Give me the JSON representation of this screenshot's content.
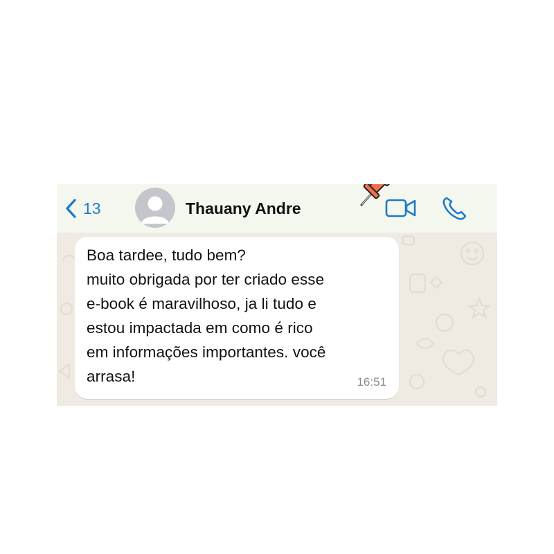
{
  "header": {
    "back_count": "13",
    "contact_name": "Thauany Andre",
    "icons": {
      "back": "chevron-left-icon",
      "avatar": "default-avatar-icon",
      "pin": "push-pin-icon",
      "video": "video-camera-icon",
      "call": "phone-icon"
    }
  },
  "message": {
    "lines": [
      "Boa tardee, tudo bem?",
      "muito obrigada por ter criado esse",
      "e-book é maravilhoso, ja li tudo e",
      "estou impactada em como é rico",
      "em informações importantes. você",
      "arrasa!"
    ],
    "time": "16:51"
  },
  "colors": {
    "accent_blue": "#1d7ac9",
    "header_bg": "#f4f7ee",
    "chat_bg": "#efeae2",
    "bubble_bg": "#ffffff",
    "pin_orange": "#f26f4b"
  }
}
